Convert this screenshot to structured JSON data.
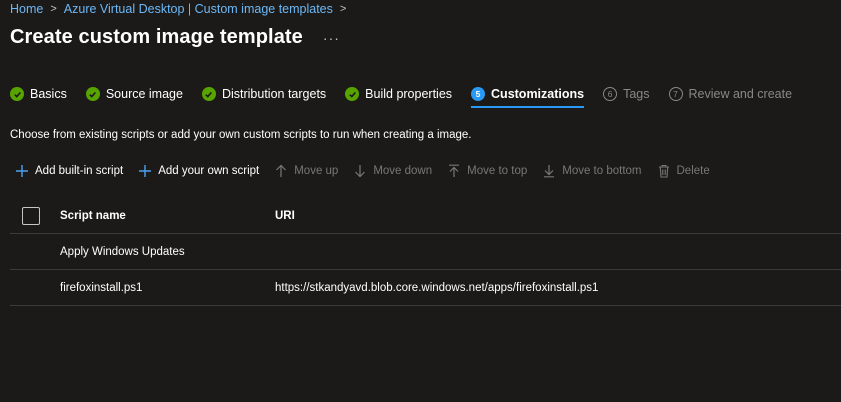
{
  "breadcrumb": {
    "items": [
      "Home",
      "Azure Virtual Desktop | Custom image templates"
    ]
  },
  "header": {
    "title": "Create custom image template",
    "more": "···"
  },
  "steps": [
    {
      "label": "Basics",
      "state": "done"
    },
    {
      "label": "Source image",
      "state": "done"
    },
    {
      "label": "Distribution targets",
      "state": "done"
    },
    {
      "label": "Build properties",
      "state": "done"
    },
    {
      "label": "Customizations",
      "state": "active",
      "number": "5"
    },
    {
      "label": "Tags",
      "state": "pending",
      "number": "6"
    },
    {
      "label": "Review and create",
      "state": "pending",
      "number": "7"
    }
  ],
  "description": "Choose from existing scripts or add your own custom scripts to run when creating a image.",
  "toolbar": {
    "add_builtin": "Add built-in script",
    "add_own": "Add your own script",
    "move_up": "Move up",
    "move_down": "Move down",
    "move_top": "Move to top",
    "move_bottom": "Move to bottom",
    "delete": "Delete"
  },
  "table": {
    "columns": [
      "Script name",
      "URI"
    ],
    "rows": [
      {
        "name": "Apply Windows Updates",
        "uri": ""
      },
      {
        "name": "firefoxinstall.ps1",
        "uri": "https://stkandyavd.blob.core.windows.net/apps/firefoxinstall.ps1"
      }
    ]
  },
  "colors": {
    "background": "#1b1a19",
    "link": "#6cb8f6",
    "success": "#57a300",
    "accent": "#2899f5",
    "disabled": "#797775"
  }
}
